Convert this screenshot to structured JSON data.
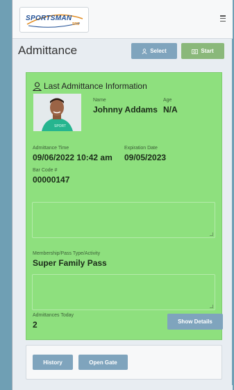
{
  "header": {
    "logo_text": "SPORTSMAN",
    "logo_sub": "SRS",
    "menu_icon": "hamburger-icon"
  },
  "page": {
    "title": "Admittance",
    "select_label": "Select",
    "start_label": "Start",
    "select_icon": "user-icon",
    "start_icon": "camera-icon"
  },
  "card": {
    "title": "Last Admittance Information",
    "title_icon": "user-icon",
    "name_label": "Name",
    "name": "Johnny Addams",
    "age_label": "Age",
    "age": "N/A",
    "admittance_time_label": "Admittance Time",
    "admittance_time": "09/06/2022 10:42 am",
    "expiration_label": "Expiration Date",
    "expiration": "09/05/2023",
    "barcode_label": "Bar Code #",
    "barcode": "00000147",
    "notes_value": "",
    "membership_label": "Membership/Pass Type/Activity",
    "membership": "Super Family Pass",
    "pass_notes_value": "",
    "today_label": "Admittances Today",
    "today": "2",
    "details_label": "Show Details"
  },
  "bottom": {
    "history_label": "History",
    "open_gate_label": "Open Gate"
  },
  "colors": {
    "card_bg": "#8ee07e",
    "button_blue": "#7fa4bd",
    "button_green": "#8ab87a",
    "background": "#6f9fb4"
  }
}
